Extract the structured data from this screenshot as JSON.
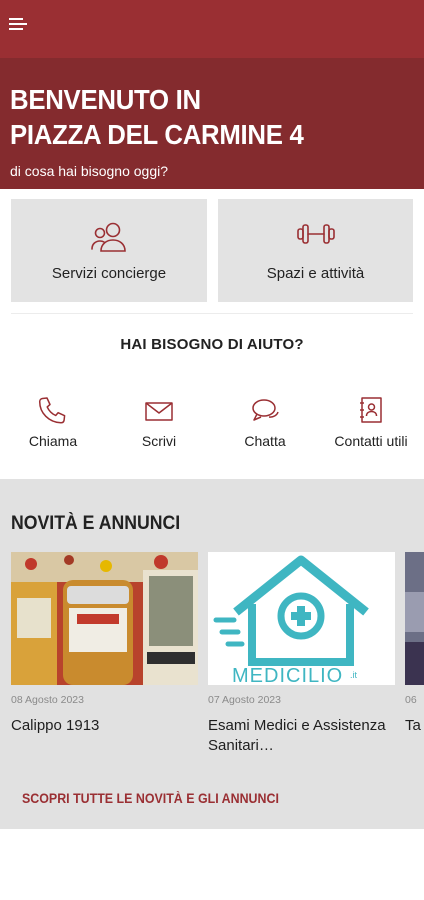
{
  "header": {
    "menu_icon": "hamburger-icon",
    "color": "#9a2f33"
  },
  "hero": {
    "title_line1": "BENVENUTO IN",
    "title_line2": "PIAZZA DEL CARMINE 4",
    "subtitle": "di cosa hai bisogno oggi?",
    "color": "#842b2e"
  },
  "tiles": [
    {
      "label": "Servizi concierge",
      "icon": "users-icon"
    },
    {
      "label": "Spazi e attività",
      "icon": "dumbbell-icon"
    }
  ],
  "help": {
    "title": "HAI BISOGNO DI AIUTO?",
    "actions": [
      {
        "label": "Chiama",
        "icon": "phone-icon"
      },
      {
        "label": "Scrivi",
        "icon": "mail-icon"
      },
      {
        "label": "Chatta",
        "icon": "chat-icon"
      },
      {
        "label": "Contatti utili",
        "icon": "contacts-book-icon"
      }
    ]
  },
  "news": {
    "title": "NOVITÀ E ANNUNCI",
    "cards": [
      {
        "date": "08 Agosto 2023",
        "title": "Calippo 1913"
      },
      {
        "date": "07 Agosto 2023",
        "title": "Esami Medici e Assistenza Sanitari…",
        "image_text": "MEDICILIO",
        "image_suffix": ".it"
      },
      {
        "date": "06",
        "title": "Ta"
      }
    ],
    "link": "SCOPRI TUTTE LE NOVITÀ E GLI ANNUNCI",
    "accent": "#9a2f33"
  }
}
